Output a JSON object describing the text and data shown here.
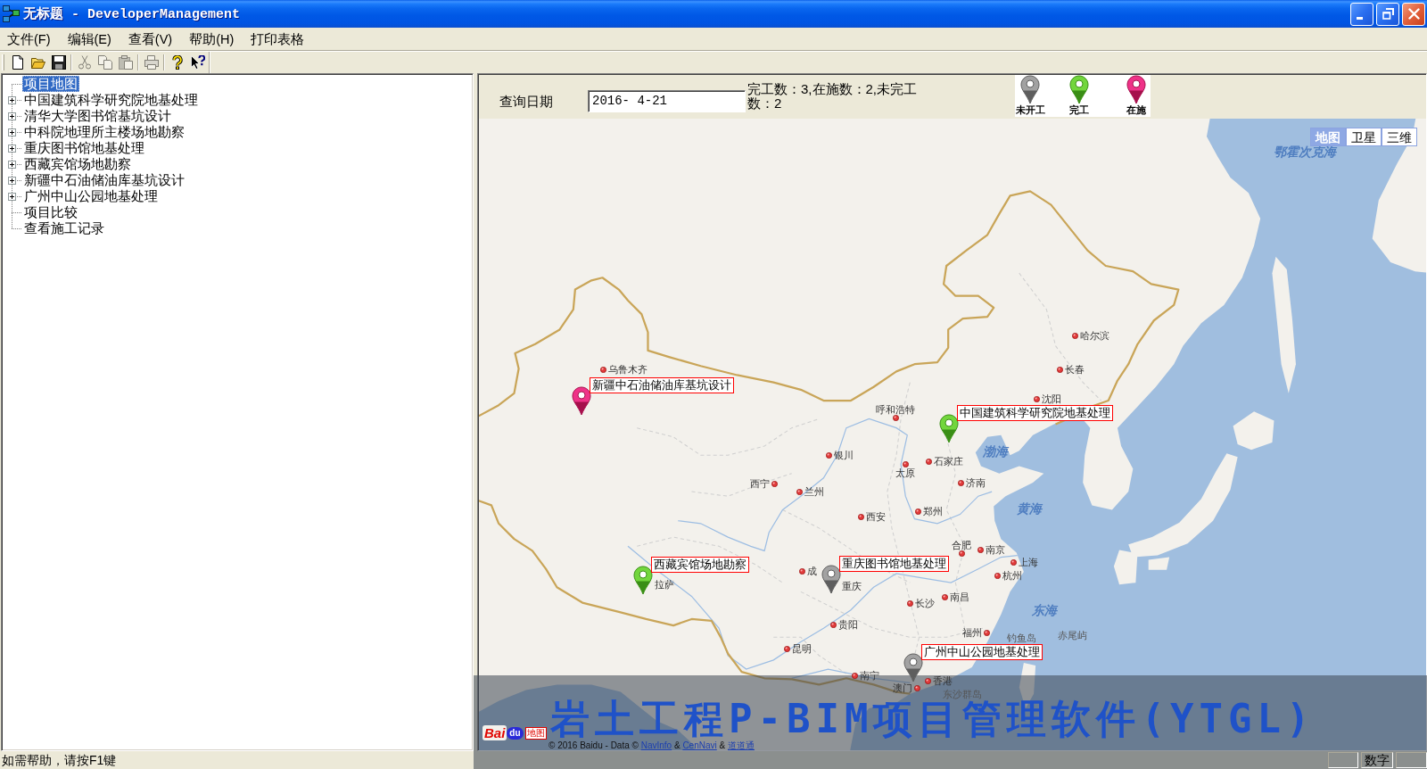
{
  "window": {
    "title": "无标题 - DeveloperManagement"
  },
  "menu": [
    {
      "label": "文件(F)"
    },
    {
      "label": "编辑(E)"
    },
    {
      "label": "查看(V)"
    },
    {
      "label": "帮助(H)"
    },
    {
      "label": "打印表格"
    }
  ],
  "toolbar": [
    {
      "disabled": false
    },
    {
      "disabled": false
    },
    {
      "disabled": false
    },
    {
      "disabled": true
    },
    {
      "disabled": true
    },
    {
      "disabled": true
    },
    {
      "disabled": true
    },
    {
      "disabled": false
    },
    {
      "disabled": false
    }
  ],
  "tree": [
    {
      "label": "项目地图",
      "kind": "leaf",
      "selected": true
    },
    {
      "label": "中国建筑科学研究院地基处理",
      "kind": "group",
      "expanded": false,
      "selected": false
    },
    {
      "label": "清华大学图书馆基坑设计",
      "kind": "group",
      "expanded": false,
      "selected": false
    },
    {
      "label": "中科院地理所主楼场地勘察",
      "kind": "group",
      "expanded": false,
      "selected": false
    },
    {
      "label": "重庆图书馆地基处理",
      "kind": "group",
      "expanded": false,
      "selected": false
    },
    {
      "label": "西藏宾馆场地勘察",
      "kind": "group",
      "expanded": false,
      "selected": false
    },
    {
      "label": "新疆中石油储油库基坑设计",
      "kind": "group",
      "expanded": false,
      "selected": false
    },
    {
      "label": "广州中山公园地基处理",
      "kind": "group",
      "expanded": false,
      "selected": false
    },
    {
      "label": "项目比较",
      "kind": "leaf",
      "selected": false
    },
    {
      "label": "查看施工记录",
      "kind": "leaf",
      "selected": false
    }
  ],
  "query": {
    "label": "查询日期",
    "date": "2016- 4-21",
    "summary": "完工数：3,在施数：2,未完工数：2"
  },
  "legend": [
    {
      "label": "未开工",
      "kind": "idle"
    },
    {
      "label": "完工",
      "kind": "done"
    },
    {
      "label": "在施",
      "kind": "active"
    }
  ],
  "map": {
    "types": [
      {
        "label": "地图",
        "selected": true
      },
      {
        "label": "卫星",
        "selected": false
      },
      {
        "label": "三维",
        "selected": false
      }
    ],
    "places": [
      {
        "name": "鄂霍次克海",
        "kind": "sea"
      },
      {
        "name": "哈尔滨",
        "kind": "city"
      },
      {
        "name": "长春",
        "kind": "city"
      },
      {
        "name": "乌鲁木齐",
        "kind": "city"
      },
      {
        "name": "沈阳",
        "kind": "city"
      },
      {
        "name": "呼和浩特",
        "kind": "city"
      },
      {
        "name": "渤海",
        "kind": "sea"
      },
      {
        "name": "银川",
        "kind": "city"
      },
      {
        "name": "石家庄",
        "kind": "city"
      },
      {
        "name": "太原",
        "kind": "city"
      },
      {
        "name": "济南",
        "kind": "city"
      },
      {
        "name": "西宁",
        "kind": "city"
      },
      {
        "name": "兰州",
        "kind": "city"
      },
      {
        "name": "黄海",
        "kind": "sea"
      },
      {
        "name": "郑州",
        "kind": "city"
      },
      {
        "name": "西安",
        "kind": "city"
      },
      {
        "name": "合肥",
        "kind": "city"
      },
      {
        "name": "南京",
        "kind": "city"
      },
      {
        "name": "上海",
        "kind": "city"
      },
      {
        "name": "成",
        "kind": "city"
      },
      {
        "name": "杭州",
        "kind": "city"
      },
      {
        "name": "拉萨",
        "kind": "label"
      },
      {
        "name": "重庆",
        "kind": "label"
      },
      {
        "name": "南昌",
        "kind": "city"
      },
      {
        "name": "长沙",
        "kind": "city"
      },
      {
        "name": "东海",
        "kind": "sea"
      },
      {
        "name": "贵阳",
        "kind": "city"
      },
      {
        "name": "福州",
        "kind": "city"
      },
      {
        "name": "钓鱼岛",
        "kind": "island"
      },
      {
        "name": "赤尾屿",
        "kind": "island"
      },
      {
        "name": "昆明",
        "kind": "city"
      },
      {
        "name": "南宁",
        "kind": "city"
      },
      {
        "name": "香港",
        "kind": "city"
      },
      {
        "name": "澳门",
        "kind": "city"
      },
      {
        "name": "东沙群岛",
        "kind": "island"
      }
    ],
    "markers": [
      {
        "label": "新疆中石油储油库基坑设计",
        "kind": "active"
      },
      {
        "label": "中国建筑科学研究院地基处理",
        "kind": "done"
      },
      {
        "label": "西藏宾馆场地勘察",
        "kind": "done"
      },
      {
        "label": "重庆图书馆地基处理",
        "kind": "idle"
      },
      {
        "label": "广州中山公园地基处理",
        "kind": "idle"
      }
    ],
    "logo": {
      "wordmark": "Bai",
      "badge": "du",
      "label": "地图"
    },
    "copyright": [
      {
        "text": "© 2016 Baidu - Data © ",
        "link": false
      },
      {
        "text": "NavInfo",
        "link": true
      },
      {
        "text": " & ",
        "link": false
      },
      {
        "text": "CenNavi",
        "link": true
      },
      {
        "text": " & ",
        "link": false
      },
      {
        "text": "道道通",
        "link": true
      }
    ]
  },
  "banner": {
    "title": "岩土工程P-BIM项目管理软件(YTGL)"
  },
  "status_bar": {
    "message": "如需帮助，请按F1键",
    "indicator": "数字"
  }
}
